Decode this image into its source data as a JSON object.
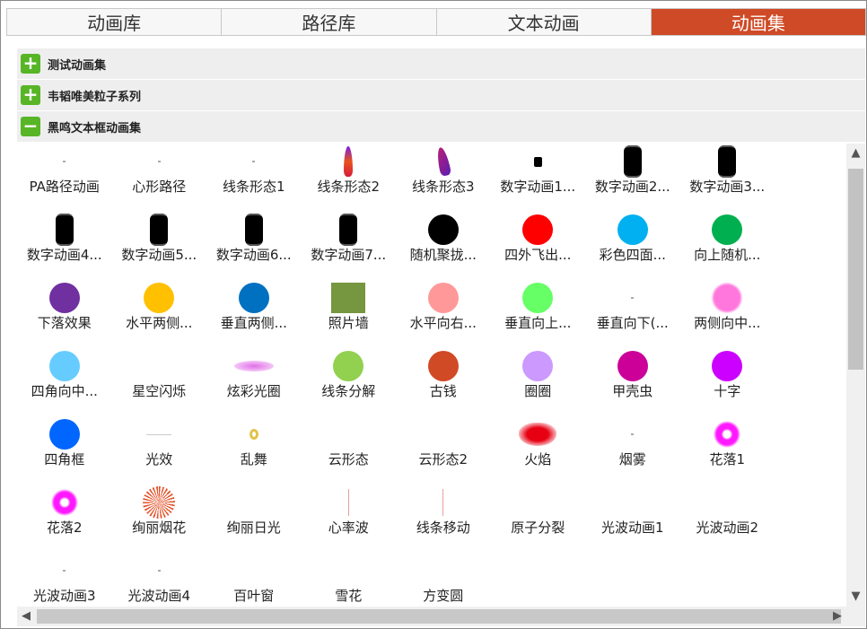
{
  "tabs": [
    "动画库",
    "路径库",
    "文本动画",
    "动画集"
  ],
  "active_tab": 3,
  "groups": [
    {
      "icon": "plus-icon",
      "symbol": "+",
      "label": "测试动画集"
    },
    {
      "icon": "plus-icon",
      "symbol": "+",
      "label": "韦韬唯美粒子系列"
    },
    {
      "icon": "minus-icon",
      "symbol": "−",
      "label": "黑鸣文本框动画集"
    }
  ],
  "items": [
    {
      "label": "PA路径动画",
      "thumb": "tiny"
    },
    {
      "label": "心形路径",
      "thumb": "tiny"
    },
    {
      "label": "线条形态1",
      "thumb": "tiny"
    },
    {
      "label": "线条形态2",
      "thumb": "flame"
    },
    {
      "label": "线条形态3",
      "thumb": "flame2"
    },
    {
      "label": "数字动画1...",
      "thumb": "smallsq"
    },
    {
      "label": "数字动画2...",
      "thumb": "blob"
    },
    {
      "label": "数字动画3...",
      "thumb": "blob"
    },
    {
      "label": "数字动画4...",
      "thumb": "blob"
    },
    {
      "label": "数字动画5...",
      "thumb": "blob"
    },
    {
      "label": "数字动画6...",
      "thumb": "blob"
    },
    {
      "label": "数字动画7...",
      "thumb": "blob"
    },
    {
      "label": "随机聚拢...",
      "thumb": "dot",
      "color": "#000000"
    },
    {
      "label": "四外飞出...",
      "thumb": "dot",
      "color": "#ff0000"
    },
    {
      "label": "彩色四面...",
      "thumb": "dot",
      "color": "#00b0f0"
    },
    {
      "label": "向上随机...",
      "thumb": "dot",
      "color": "#00b050"
    },
    {
      "label": "下落效果",
      "thumb": "dot",
      "color": "#7030a0"
    },
    {
      "label": "水平两侧...",
      "thumb": "dot",
      "color": "#ffc000"
    },
    {
      "label": "垂直两侧...",
      "thumb": "dot",
      "color": "#0070c0"
    },
    {
      "label": "照片墙",
      "thumb": "square"
    },
    {
      "label": "水平向右...",
      "thumb": "dot",
      "color": "#ff9999"
    },
    {
      "label": "垂直向上...",
      "thumb": "dot",
      "color": "#66ff66"
    },
    {
      "label": "垂直向下(...",
      "thumb": "tiny"
    },
    {
      "label": "两侧向中...",
      "thumb": "fuzzy",
      "color": "#ff77dd"
    },
    {
      "label": "四角向中...",
      "thumb": "dot",
      "color": "#66ccff"
    },
    {
      "label": "星空闪烁",
      "thumb": "none"
    },
    {
      "label": "炫彩光圈",
      "thumb": "halo"
    },
    {
      "label": "线条分解",
      "thumb": "dot",
      "color": "#92d050"
    },
    {
      "label": "古钱",
      "thumb": "dot",
      "color": "#d04a26"
    },
    {
      "label": "圈圈",
      "thumb": "dot",
      "color": "#cc99ff"
    },
    {
      "label": "甲壳虫",
      "thumb": "dot",
      "color": "#cc0099"
    },
    {
      "label": "十字",
      "thumb": "dot",
      "color": "#cc00ff"
    },
    {
      "label": "四角框",
      "thumb": "dot",
      "color": "#0066ff"
    },
    {
      "label": "光效",
      "thumb": "line"
    },
    {
      "label": "乱舞",
      "thumb": "ring"
    },
    {
      "label": "云形态",
      "thumb": "none"
    },
    {
      "label": "云形态2",
      "thumb": "none"
    },
    {
      "label": "火焰",
      "thumb": "fire"
    },
    {
      "label": "烟雾",
      "thumb": "tiny"
    },
    {
      "label": "花落1",
      "thumb": "flower"
    },
    {
      "label": "花落2",
      "thumb": "flower"
    },
    {
      "label": "绚丽烟花",
      "thumb": "burst"
    },
    {
      "label": "绚丽日光",
      "thumb": "none"
    },
    {
      "label": "心率波",
      "thumb": "vline"
    },
    {
      "label": "线条移动",
      "thumb": "vline"
    },
    {
      "label": "原子分裂",
      "thumb": "none"
    },
    {
      "label": "光波动画1",
      "thumb": "none"
    },
    {
      "label": "光波动画2",
      "thumb": "none"
    },
    {
      "label": "光波动画3",
      "thumb": "tiny"
    },
    {
      "label": "光波动画4",
      "thumb": "tiny"
    },
    {
      "label": "百叶窗",
      "thumb": "none"
    },
    {
      "label": "雪花",
      "thumb": "none"
    },
    {
      "label": "方变圆",
      "thumb": "none"
    }
  ],
  "scrollbar": {
    "up": "▲",
    "down": "▼",
    "left": "◀",
    "right": "▶"
  }
}
